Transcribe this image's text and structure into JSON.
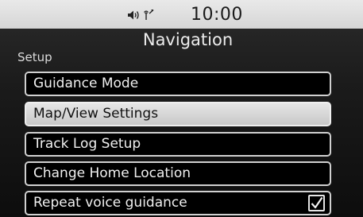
{
  "status": {
    "time": "10:00",
    "icons": [
      "speaker-icon",
      "wireless-signal-icon"
    ]
  },
  "header": {
    "title": "Navigation"
  },
  "section": {
    "label": "Setup"
  },
  "menu": {
    "items": [
      {
        "label": "Guidance Mode",
        "selected": false
      },
      {
        "label": "Map/View Settings",
        "selected": true
      },
      {
        "label": "Track Log Setup",
        "selected": false
      },
      {
        "label": "Change Home Location",
        "selected": false
      },
      {
        "label": "Repeat voice guidance",
        "selected": false,
        "checked": true
      }
    ]
  },
  "colors": {
    "status_bar": "#e0e0e0",
    "background": "#1b1b1b",
    "item_border": "#d0d0d0",
    "selected_fill": "#d6d6d6"
  }
}
